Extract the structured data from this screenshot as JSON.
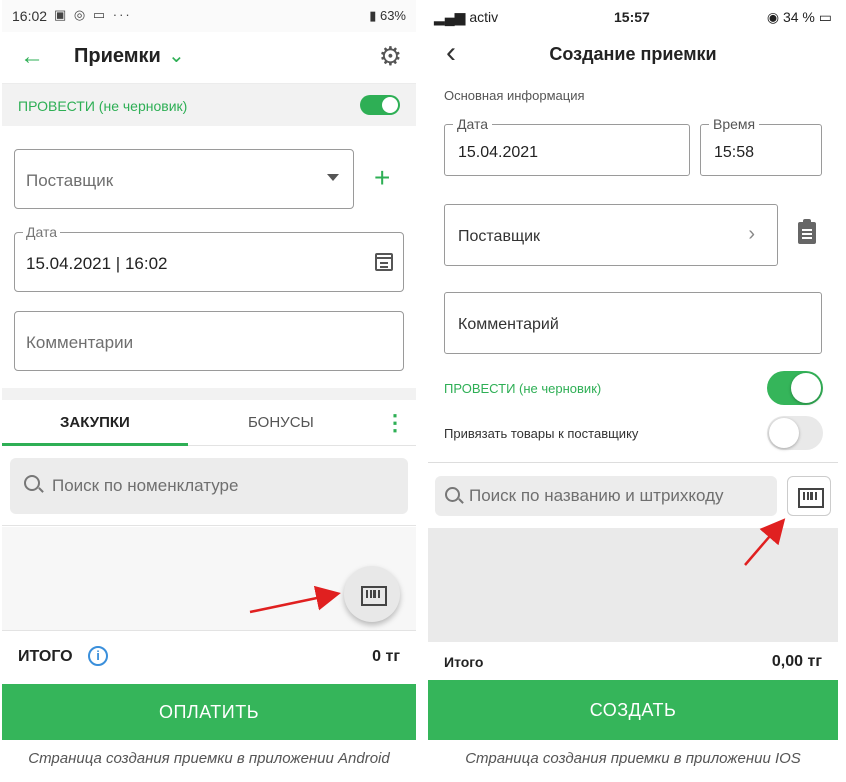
{
  "android": {
    "status": {
      "time": "16:02",
      "icons_left": "▣ ◎ ▭ ···",
      "right": "63%"
    },
    "toolbar": {
      "title": "Приемки"
    },
    "post_label": "ПРОВЕСТИ (не черновик)",
    "post_toggle_on": true,
    "supplier_placeholder": "Поставщик",
    "date_legend": "Дата",
    "date_value": "15.04.2021 | 16:02",
    "comment_placeholder": "Комментарии",
    "tabs": [
      {
        "label": "ЗАКУПКИ",
        "active": true
      },
      {
        "label": "БОНУСЫ",
        "active": false
      }
    ],
    "search_placeholder": "Поиск по номенклатуре",
    "total_label": "ИТОГО",
    "total_value": "0 тг",
    "pay_button": "ОПЛАТИТЬ",
    "caption": "Страница создания приемки в приложении Android"
  },
  "ios": {
    "status": {
      "carrier": "activ",
      "time": "15:57",
      "battery": "34 %"
    },
    "nav_title": "Создание приемки",
    "section_title": "Основная информация",
    "date_legend": "Дата",
    "date_value": "15.04.2021",
    "time_legend": "Время",
    "time_value": "15:58",
    "supplier_placeholder": "Поставщик",
    "comment_placeholder": "Комментарий",
    "post_label": "ПРОВЕСТИ (не черновик)",
    "post_toggle_on": true,
    "link_label": "Привязать товары к поставщику",
    "link_toggle_on": false,
    "search_placeholder": "Поиск по названию и штрихкоду",
    "total_label": "Итого",
    "total_value": "0,00 тг",
    "create_button": "СОЗДАТЬ",
    "caption": "Страница создания приемки в приложении IOS"
  },
  "colors": {
    "accent_green": "#35b55a",
    "annotation_red": "#e02020",
    "info_blue": "#3a8fdb"
  }
}
